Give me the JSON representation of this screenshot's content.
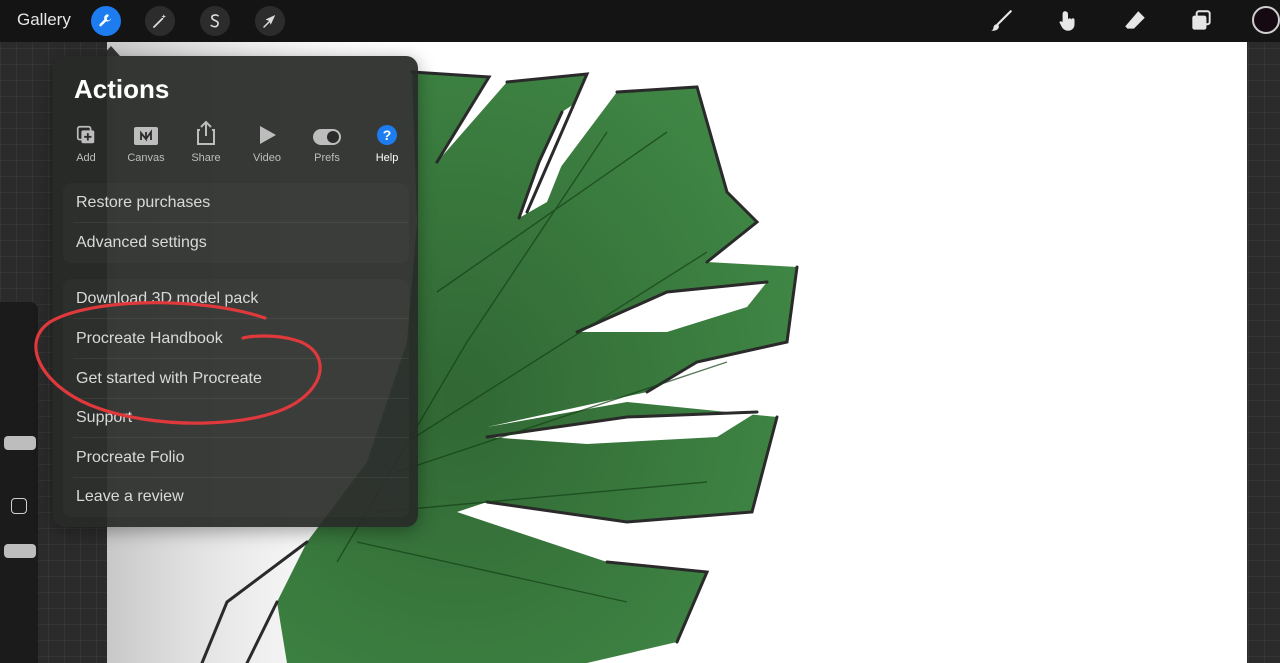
{
  "topbar": {
    "gallery_label": "Gallery",
    "tools_left": [
      "wrench-icon",
      "magic-wand-icon",
      "selection-icon",
      "transform-icon"
    ],
    "tools_right": [
      "brush-icon",
      "smudge-icon",
      "eraser-icon",
      "layers-icon"
    ],
    "accent_color": "#1c7cf0",
    "current_color": "#160a12"
  },
  "actions": {
    "title": "Actions",
    "tabs": [
      {
        "label": "Add",
        "icon": "add-icon"
      },
      {
        "label": "Canvas",
        "icon": "canvas-icon"
      },
      {
        "label": "Share",
        "icon": "share-icon"
      },
      {
        "label": "Video",
        "icon": "play-icon"
      },
      {
        "label": "Prefs",
        "icon": "toggle-icon"
      },
      {
        "label": "Help",
        "icon": "help-icon",
        "active": true
      }
    ],
    "items": [
      {
        "label": "Restore purchases"
      },
      {
        "label": "Advanced settings"
      },
      {
        "label": "Download 3D model pack"
      },
      {
        "label": "Procreate Handbook"
      },
      {
        "label": "Get started with Procreate"
      },
      {
        "label": "Support"
      },
      {
        "label": "Procreate Folio"
      },
      {
        "label": "Leave a review"
      }
    ]
  },
  "annotation": {
    "color": "#e0393c",
    "circled_items": [
      "Procreate Handbook",
      "Get started with Procreate"
    ]
  }
}
